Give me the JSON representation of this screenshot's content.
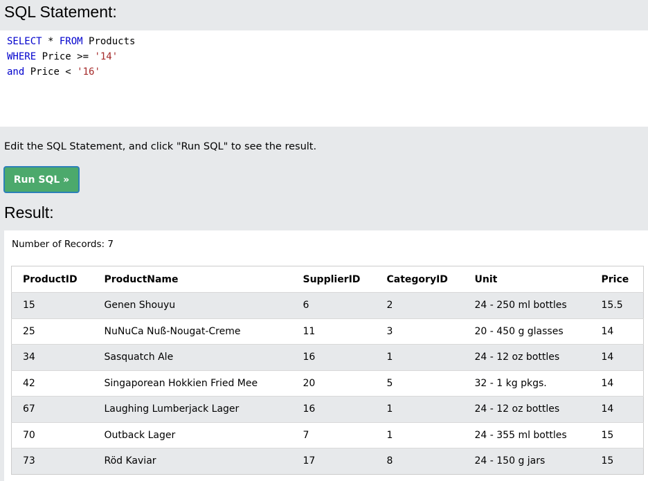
{
  "sql_heading": "SQL Statement:",
  "sql": {
    "line1": {
      "kw1": "SELECT",
      "mid": " * ",
      "kw2": "FROM",
      "rest": " Products"
    },
    "line2": {
      "kw": "WHERE",
      "rest": " Price >= ",
      "str": "'14'"
    },
    "line3": {
      "kw": "and",
      "rest": " Price < ",
      "str": "'16'"
    }
  },
  "hint": "Edit the SQL Statement, and click \"Run SQL\" to see the result.",
  "run_button": "Run SQL »",
  "result_heading": "Result:",
  "record_count": "Number of Records: 7",
  "columns": [
    "ProductID",
    "ProductName",
    "SupplierID",
    "CategoryID",
    "Unit",
    "Price"
  ],
  "rows": [
    [
      "15",
      "Genen Shouyu",
      "6",
      "2",
      "24 - 250 ml bottles",
      "15.5"
    ],
    [
      "25",
      "NuNuCa Nuß-Nougat-Creme",
      "11",
      "3",
      "20 - 450 g glasses",
      "14"
    ],
    [
      "34",
      "Sasquatch Ale",
      "16",
      "1",
      "24 - 12 oz bottles",
      "14"
    ],
    [
      "42",
      "Singaporean Hokkien Fried Mee",
      "20",
      "5",
      "32 - 1 kg pkgs.",
      "14"
    ],
    [
      "67",
      "Laughing Lumberjack Lager",
      "16",
      "1",
      "24 - 12 oz bottles",
      "14"
    ],
    [
      "70",
      "Outback Lager",
      "7",
      "1",
      "24 - 355 ml bottles",
      "15"
    ],
    [
      "73",
      "Röd Kaviar",
      "17",
      "8",
      "24 - 150 g jars",
      "15"
    ]
  ],
  "colors": {
    "keyword": "#0000cd",
    "string": "#a52a2a",
    "button": "#4ca96c",
    "stripe": "#e7e9eb"
  }
}
